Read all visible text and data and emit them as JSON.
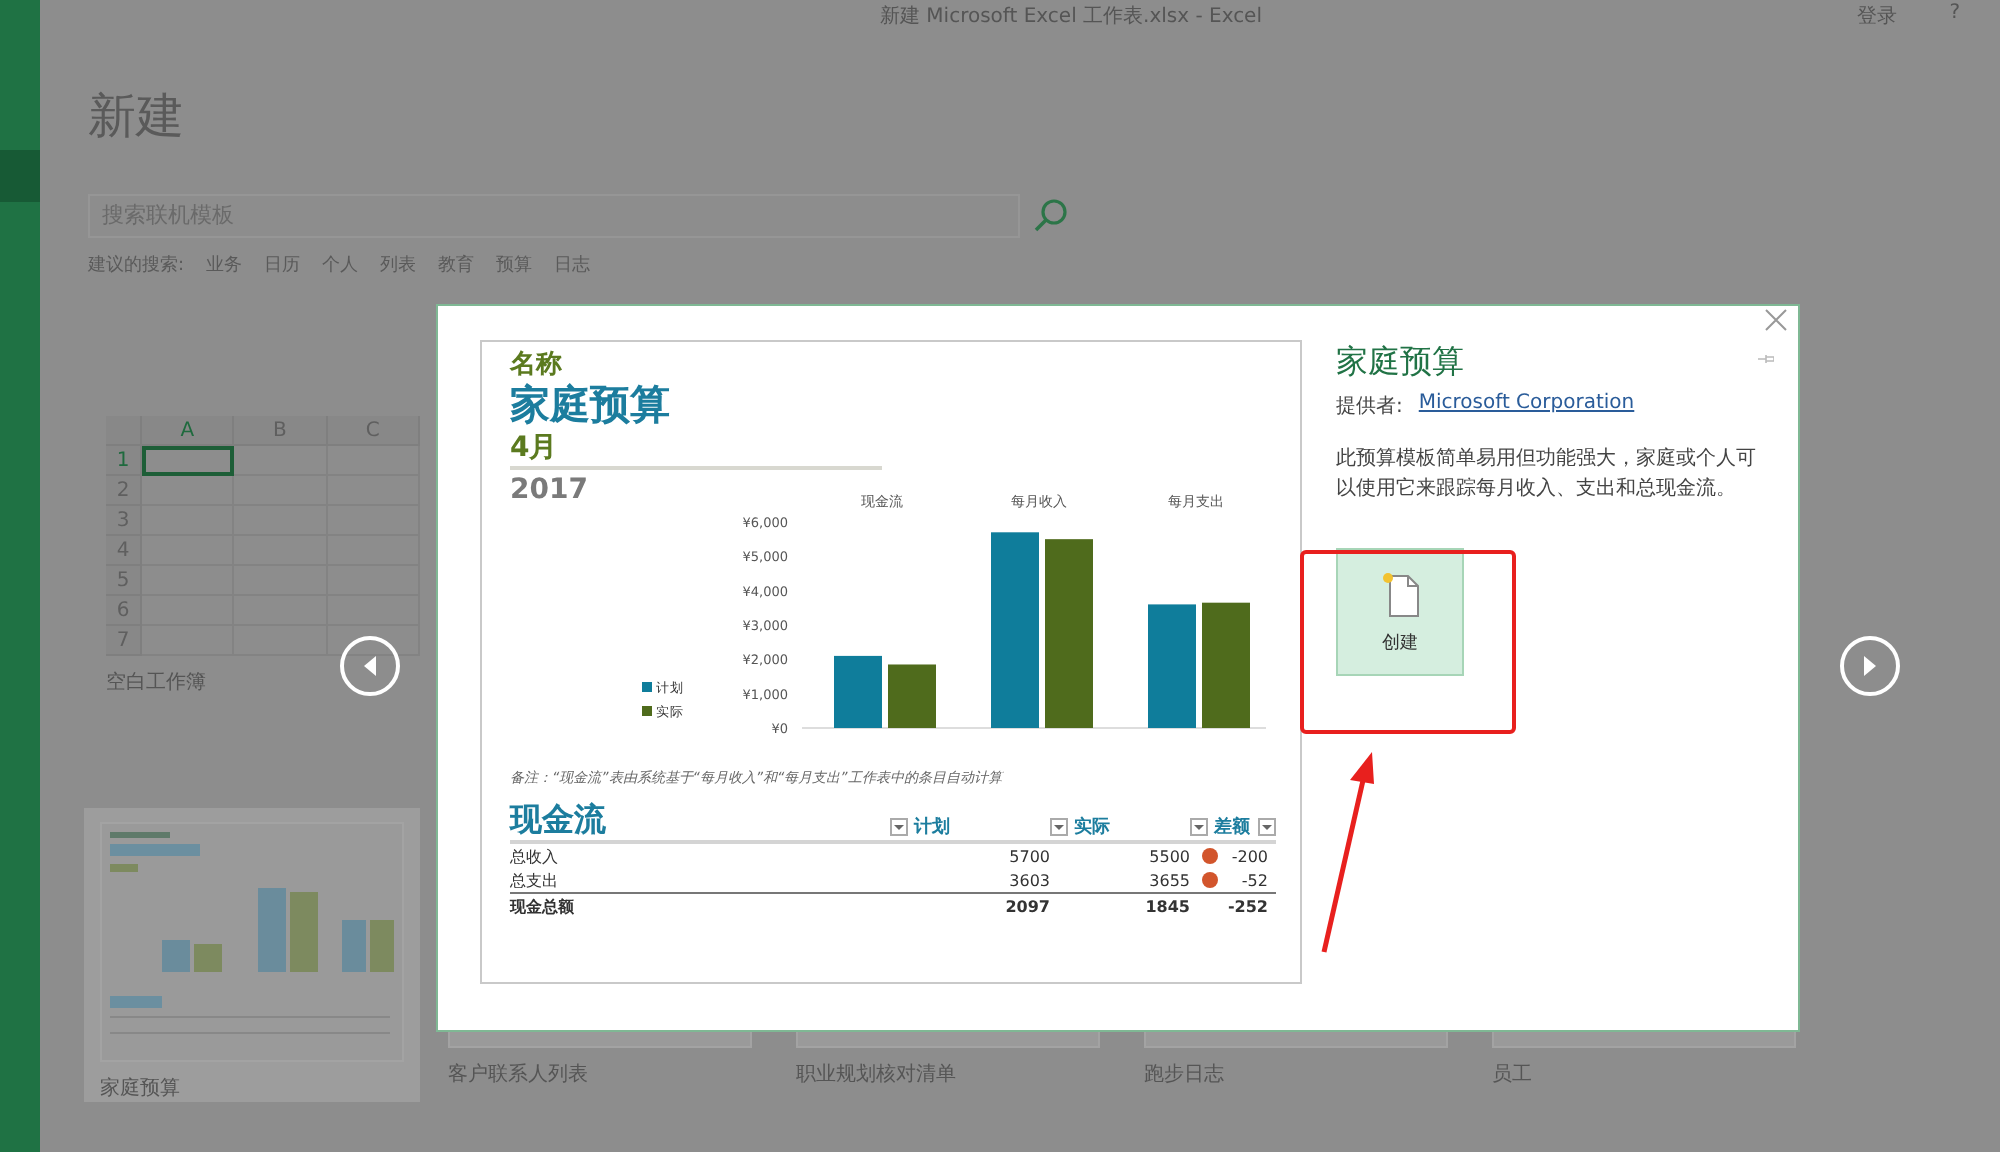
{
  "window": {
    "title": "新建 Microsoft Excel 工作表.xlsx  -  Excel",
    "sign_in": "登录",
    "help": "?"
  },
  "page": {
    "heading": "新建",
    "search": {
      "placeholder": "搜索联机模板"
    },
    "suggested_label": "建议的搜索:",
    "suggestions": [
      "业务",
      "日历",
      "个人",
      "列表",
      "教育",
      "预算",
      "日志"
    ]
  },
  "template_rows": [
    [
      {
        "kind": "blank",
        "name": "空白工作簿",
        "selected": false,
        "sheet": {
          "columns": [
            "A",
            "B",
            "C"
          ],
          "rows": [
            "1",
            "2",
            "3",
            "4",
            "5",
            "6",
            "7"
          ]
        }
      }
    ],
    [
      {
        "kind": "budget",
        "name": "家庭预算",
        "selected": true
      },
      {
        "kind": "other",
        "name": "客户联系人列表",
        "selected": false
      },
      {
        "kind": "other",
        "name": "职业规划核对清单",
        "selected": false
      },
      {
        "kind": "other",
        "name": "跑步日志",
        "selected": false
      },
      {
        "kind": "other",
        "name": "员工",
        "selected": false
      }
    ]
  ],
  "preview_dialog": {
    "sheet": {
      "label": "名称",
      "title": "家庭预算",
      "month": "4月",
      "year": "2017",
      "chart_data": {
        "type": "bar",
        "categories": [
          "现金流",
          "每月收入",
          "每月支出"
        ],
        "series": [
          {
            "name": "计划",
            "color": "#0f7d9b",
            "values": [
              2100,
              5700,
              3600
            ]
          },
          {
            "name": "实际",
            "color": "#4f6b1c",
            "values": [
              1850,
              5500,
              3650
            ]
          }
        ],
        "legend": true,
        "ylim": [
          0,
          6000
        ],
        "yticks": [
          {
            "value": 0,
            "label": "¥0"
          },
          {
            "value": 1000,
            "label": "¥1,000"
          },
          {
            "value": 2000,
            "label": "¥2,000"
          },
          {
            "value": 3000,
            "label": "¥3,000"
          },
          {
            "value": 4000,
            "label": "¥4,000"
          },
          {
            "value": 5000,
            "label": "¥5,000"
          },
          {
            "value": 6000,
            "label": "¥6,000"
          }
        ]
      },
      "note": "备注：“现金流”表由系统基于“每月收入”和“每月支出”工作表中的条目自动计算",
      "table": {
        "title": "现金流",
        "columns": [
          "计划",
          "实际",
          "差额"
        ],
        "rows": [
          {
            "label": "总收入",
            "plan": "5700",
            "actual": "5500",
            "flag": true,
            "diff": "-200",
            "total": false
          },
          {
            "label": "总支出",
            "plan": "3603",
            "actual": "3655",
            "flag": true,
            "diff": "-52",
            "total": false
          },
          {
            "label": "现金总额",
            "plan": "2097",
            "actual": "1845",
            "flag": false,
            "diff": "-252",
            "total": true
          }
        ]
      }
    },
    "title": "家庭预算",
    "provider_label": "提供者:",
    "provider": "Microsoft Corporation",
    "description": "此预算模板简单易用但功能强大，家庭或个人可以使用它来跟踪每月收入、支出和总现金流。",
    "create_button": "创建"
  }
}
